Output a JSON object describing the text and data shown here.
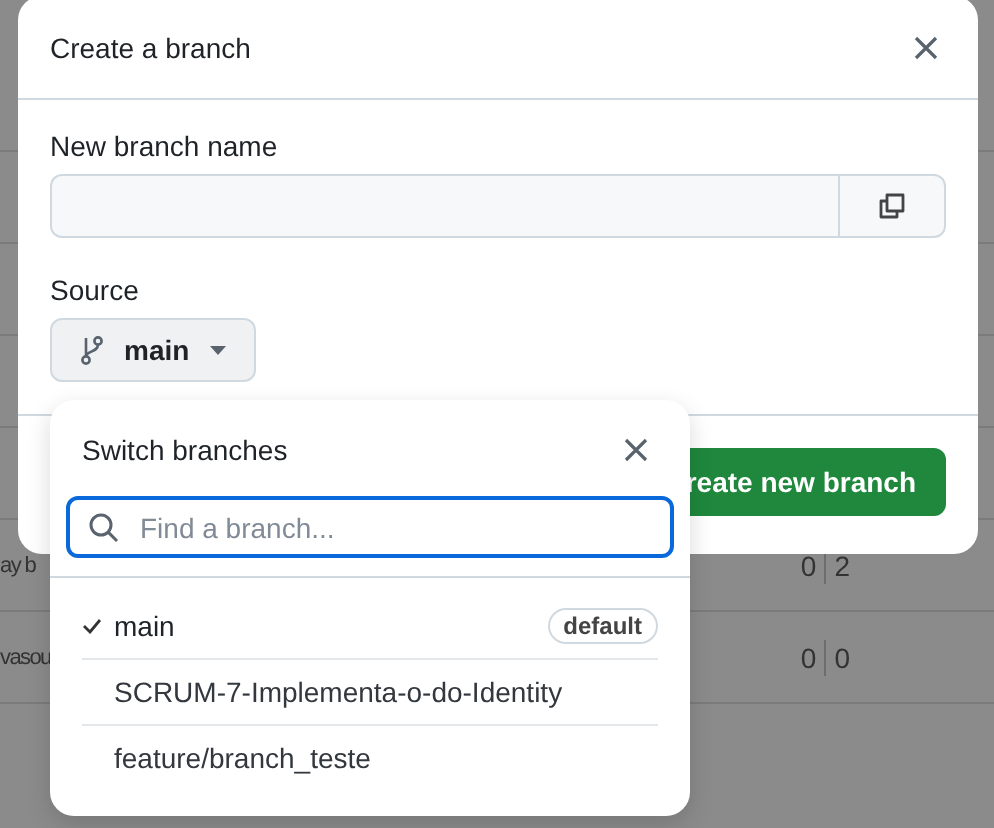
{
  "background_rows": [
    {
      "text": "ay b",
      "ahead": "0",
      "behind": "2"
    },
    {
      "text": "vasou",
      "ahead": "0",
      "behind": "0"
    }
  ],
  "dialog": {
    "title": "Create a branch",
    "name_label": "New branch name",
    "source_label": "Source",
    "source_branch": "main",
    "submit_button": "reate new branch"
  },
  "branch_menu": {
    "title": "Switch branches",
    "search": {
      "placeholder": "Find a branch..."
    },
    "branches": [
      {
        "name": "main",
        "selected": true,
        "badge": "default"
      },
      {
        "name": "SCRUM-7-Implementa-o-do-Identity",
        "selected": false
      },
      {
        "name": "feature/branch_teste",
        "selected": false
      }
    ]
  }
}
